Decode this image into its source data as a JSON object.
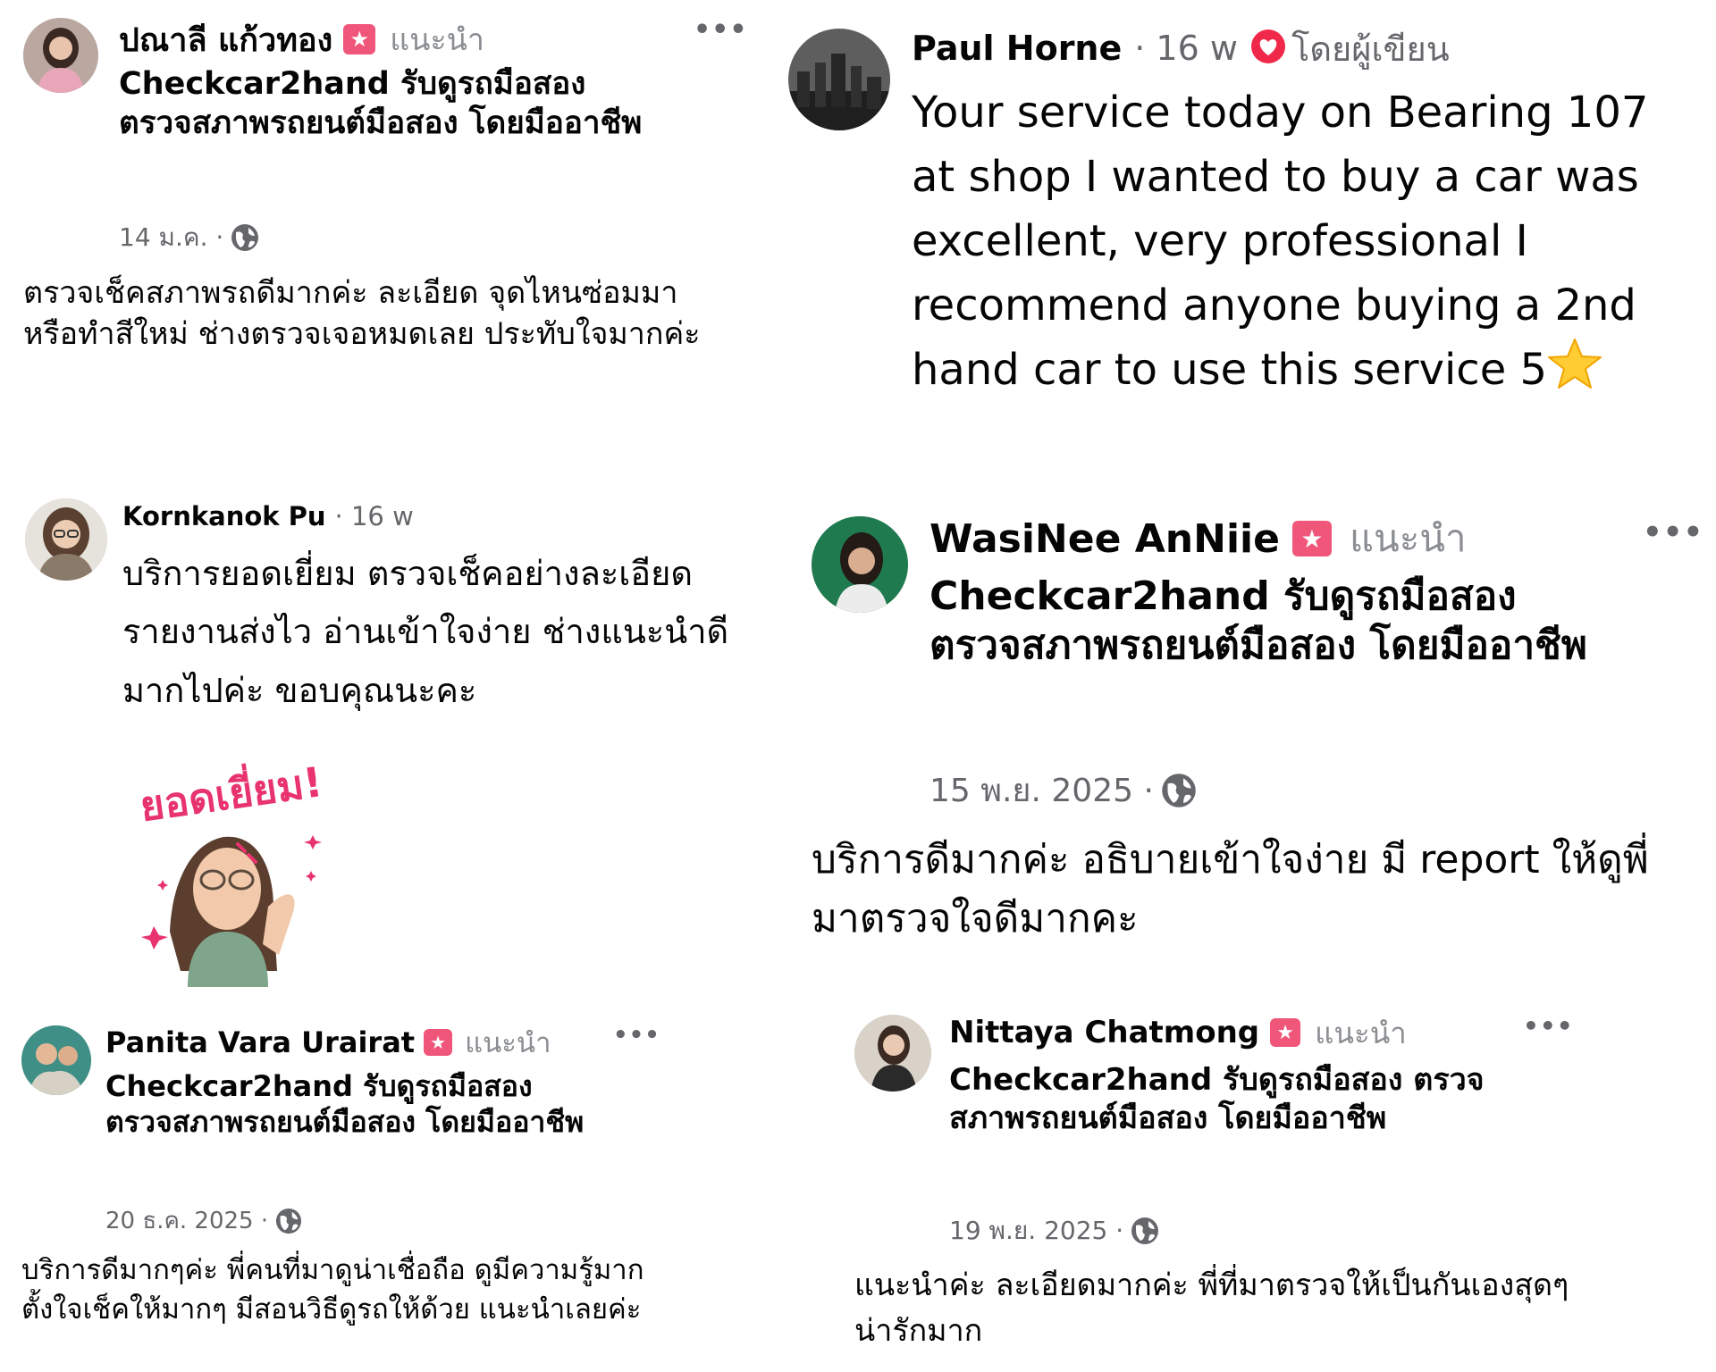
{
  "colors": {
    "name_text": "#050505",
    "meta_text": "#65676b",
    "badge_pink": "#f0557a",
    "heart_red": "#f02849",
    "sticker_pink": "#e8336e"
  },
  "reviews": {
    "r1": {
      "name": "ปณาลี แก้วทอง",
      "badge_icon": "recommend-star-icon",
      "recommend": "แนะนำ",
      "menu": "•••",
      "page": "Checkcar2hand รับดูรถมือสอง ตรวจสภาพรถยนต์มือสอง โดยมืออาชีพ",
      "date": "14 ม.ค. ·",
      "privacy_icon": "globe-icon",
      "text": "ตรวจเช็คสภาพรถดีมากค่ะ ละเอียด จุดไหนซ่อมมา หรือทำสีใหม่ ช่างตรวจเจอหมดเลย ประทับใจมากค่ะ"
    },
    "r2": {
      "name": "Paul Horne",
      "time": "· 16 w",
      "heart_icon": "heart-icon",
      "author_label": "โดยผู้เขียน",
      "text": "Your service today on Bearing 107 at shop I wanted to buy a car was excellent, very professional I recommend anyone buying a 2nd hand car to use this service 5",
      "emoji": "star-emoji"
    },
    "r3": {
      "name": "Kornkanok Pu",
      "time": "· 16 w",
      "text": "บริการยอดเยี่ยม ตรวจเช็คอย่างละเอียด รายงานส่งไว อ่านเข้าใจง่าย ช่างแนะนำดีมากไปค่ะ ขอบคุณนะคะ",
      "sticker_text": "ยอดเยี่ยม!"
    },
    "r4": {
      "name": "WasiNee AnNiie",
      "recommend": "แนะนำ",
      "menu": "•••",
      "page": "Checkcar2hand รับดูรถมือสอง ตรวจสภาพรถยนต์มือสอง โดยมืออาชีพ",
      "date": "15 พ.ย. 2025 ·",
      "text": "บริการดีมากค่ะ อธิบายเข้าใจง่าย มี report ให้ดูพี่มาตรวจใจดีมากคะ"
    },
    "r5": {
      "name": "Panita Vara Urairat",
      "recommend": "แนะนำ",
      "menu": "•••",
      "page": "Checkcar2hand รับดูรถมือสอง ตรวจสภาพรถยนต์มือสอง โดยมืออาชีพ",
      "date": "20 ธ.ค. 2025 ·",
      "text": "บริการดีมากๆค่ะ พี่คนที่มาดูน่าเชื่อถือ ดูมีความรู้มาก ตั้งใจเช็คให้มากๆ มีสอนวิธีดูรถให้ด้วย แนะนำเลยค่ะ"
    },
    "r6": {
      "name": "Nittaya Chatmong",
      "recommend": "แนะนำ",
      "menu": "•••",
      "page": "Checkcar2hand รับดูรถมือสอง ตรวจสภาพรถยนต์มือสอง โดยมืออาชีพ",
      "date": "19 พ.ย. 2025 ·",
      "text": "แนะนำค่ะ ละเอียดมากค่ะ พี่ที่มาตรวจให้เป็นกันเองสุดๆน่ารักมาก"
    }
  }
}
